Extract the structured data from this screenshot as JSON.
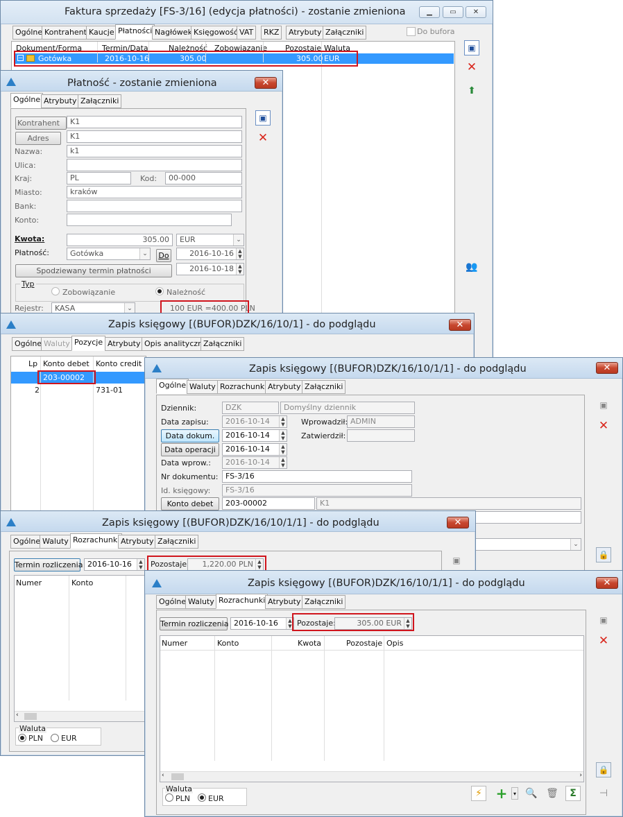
{
  "w1": {
    "title": "Faktura sprzedaży [FS-3/16] (edycja płatności) - zostanie zmieniona",
    "tabs": [
      "Ogólne",
      "Kontrahent",
      "Kaucje",
      "Płatności",
      "Nagłówek",
      "Księgowość",
      "VAT",
      "RKZ",
      "Atrybuty",
      "Załączniki"
    ],
    "do_bufora": "Do bufora",
    "columns": [
      "Dokument/Forma",
      "Termin/Data",
      "Należność",
      "Zobowiązanie",
      "Pozostaje",
      "Waluta"
    ],
    "row": {
      "forma": "Gotówka",
      "termin": "2016-10-16",
      "naleznosc": "305.00",
      "zobowiazanie": "",
      "pozostaje": "305.00",
      "waluta": "EUR"
    }
  },
  "w2": {
    "title": "Płatność - zostanie zmieniona",
    "tabs": [
      "Ogólne",
      "Atrybuty",
      "Załączniki"
    ],
    "kontrahent_btn": "Kontrahent",
    "kontrahent": "K1",
    "adres_btn": "Adres",
    "adres": "K1",
    "nazwa_lbl": "Nazwa:",
    "nazwa": "k1",
    "ulica_lbl": "Ulica:",
    "ulica": "",
    "kraj_lbl": "Kraj:",
    "kraj": "PL",
    "kod_lbl": "Kod:",
    "kod": "00-000",
    "miasto_lbl": "Miasto:",
    "miasto": "kraków",
    "bank_lbl": "Bank:",
    "bank": "",
    "konto_lbl": "Konto:",
    "konto": "",
    "kwota_lbl": "Kwota:",
    "kwota": "305.00",
    "waluta": "EUR",
    "platnosc_lbl": "Płatność:",
    "platnosc": "Gotówka",
    "do_btn": "Do",
    "do_date": "2016-10-16",
    "spodziewany_btn": "Spodziewany termin płatności",
    "spodziewany": "2016-10-18",
    "typ_lbl": "Typ",
    "zob": "Zobowiązanie",
    "nal": "Należność",
    "rejestr_lbl": "Rejestr:",
    "rejestr": "KASA",
    "kurs": "100 EUR =400.00 PLN"
  },
  "w3": {
    "title": "Zapis księgowy [(BUFOR)DZK/16/10/1] - do podglądu",
    "tabs": [
      "Ogólne",
      "Waluty",
      "Pozycje",
      "Atrybuty",
      "Opis analityczny",
      "Załączniki"
    ],
    "columns": [
      "Lp",
      "Konto debet",
      "Konto credit"
    ],
    "rows": [
      {
        "lp": "",
        "debet": "203-00002",
        "credit": ""
      },
      {
        "lp": "2",
        "debet": "",
        "credit": "731-01"
      }
    ]
  },
  "w4": {
    "title": "Zapis księgowy [(BUFOR)DZK/16/10/1/1] - do podglądu",
    "tabs": [
      "Ogólne",
      "Waluty",
      "Rozrachunki",
      "Atrybuty",
      "Załączniki"
    ],
    "dziennik_lbl": "Dziennik:",
    "dziennik": "DZK",
    "dziennik_desc": "Domyślny dziennik",
    "data_zapisu_lbl": "Data zapisu:",
    "data_zapisu": "2016-10-14",
    "wprowadzil_lbl": "Wprowadził:",
    "wprowadzil": "ADMIN",
    "data_dok_btn": "Data dokum.",
    "data_dok": "2016-10-14",
    "zatwierdzil_lbl": "Zatwierdził:",
    "zatwierdzil": "",
    "data_op_btn": "Data operacji",
    "data_op": "2016-10-14",
    "data_wprow_lbl": "Data wprow.:",
    "data_wprow": "2016-10-14",
    "nr_dok_lbl": "Nr dokumentu:",
    "nr_dok": "FS-3/16",
    "id_ksieg_lbl": "Id. księgowy:",
    "id_ksieg": "FS-3/16",
    "konto_debet_btn": "Konto debet",
    "konto_debet": "203-00002",
    "konto_debet_name": "K1"
  },
  "w5": {
    "title": "Zapis księgowy [(BUFOR)DZK/16/10/1/1] - do podglądu",
    "tabs": [
      "Ogólne",
      "Waluty",
      "Rozrachunki",
      "Atrybuty",
      "Załączniki"
    ],
    "termin_btn": "Termin rozliczenia",
    "termin": "2016-10-16",
    "pozostaje_lbl": "Pozostaje:",
    "pozostaje": "1,220.00 PLN",
    "columns": [
      "Numer",
      "Konto"
    ],
    "waluta_lbl": "Waluta",
    "pln": "PLN",
    "eur": "EUR"
  },
  "w6": {
    "title": "Zapis księgowy [(BUFOR)DZK/16/10/1/1] - do podglądu",
    "tabs": [
      "Ogólne",
      "Waluty",
      "Rozrachunki",
      "Atrybuty",
      "Załączniki"
    ],
    "termin_btn": "Termin rozliczenia",
    "termin": "2016-10-16",
    "pozostaje_lbl": "Pozostaje:",
    "pozostaje": "305.00 EUR",
    "columns": [
      "Numer",
      "Konto",
      "Kwota",
      "Pozostaje",
      "Opis"
    ],
    "waluta_lbl": "Waluta",
    "pln": "PLN",
    "eur": "EUR"
  }
}
